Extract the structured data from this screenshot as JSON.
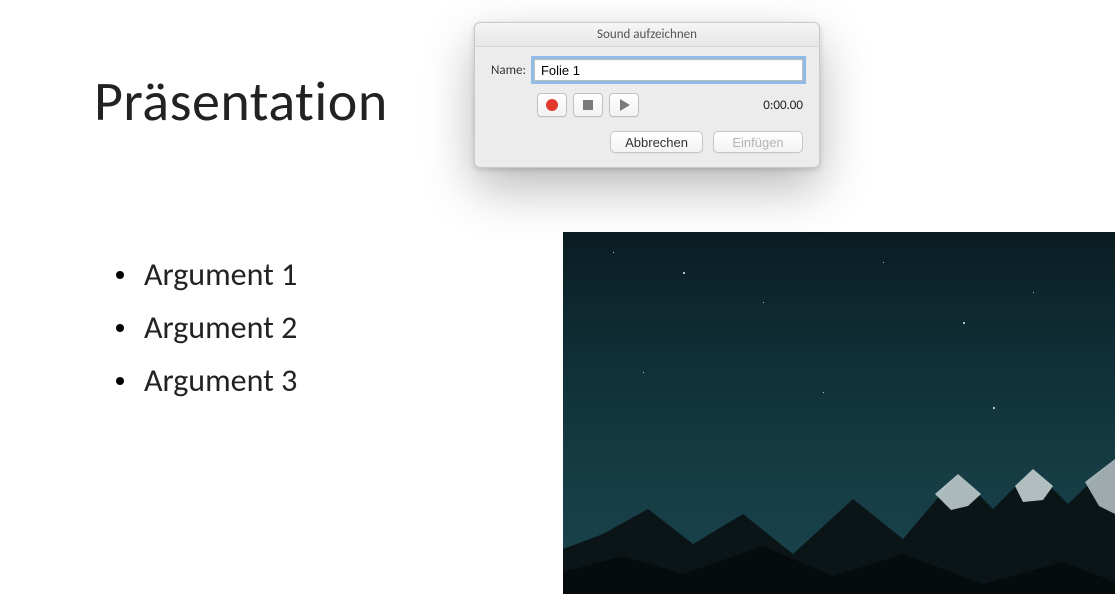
{
  "slide": {
    "title": "Präsentation",
    "bullets": [
      "Argument 1",
      "Argument 2",
      "Argument 3"
    ]
  },
  "dialog": {
    "title": "Sound aufzeichnen",
    "name_label": "Name:",
    "name_value": "Folie 1",
    "time": "0:00.00",
    "cancel_label": "Abbrechen",
    "insert_label": "Einfügen",
    "icons": {
      "record": "record-icon",
      "stop": "stop-icon",
      "play": "play-icon"
    }
  }
}
